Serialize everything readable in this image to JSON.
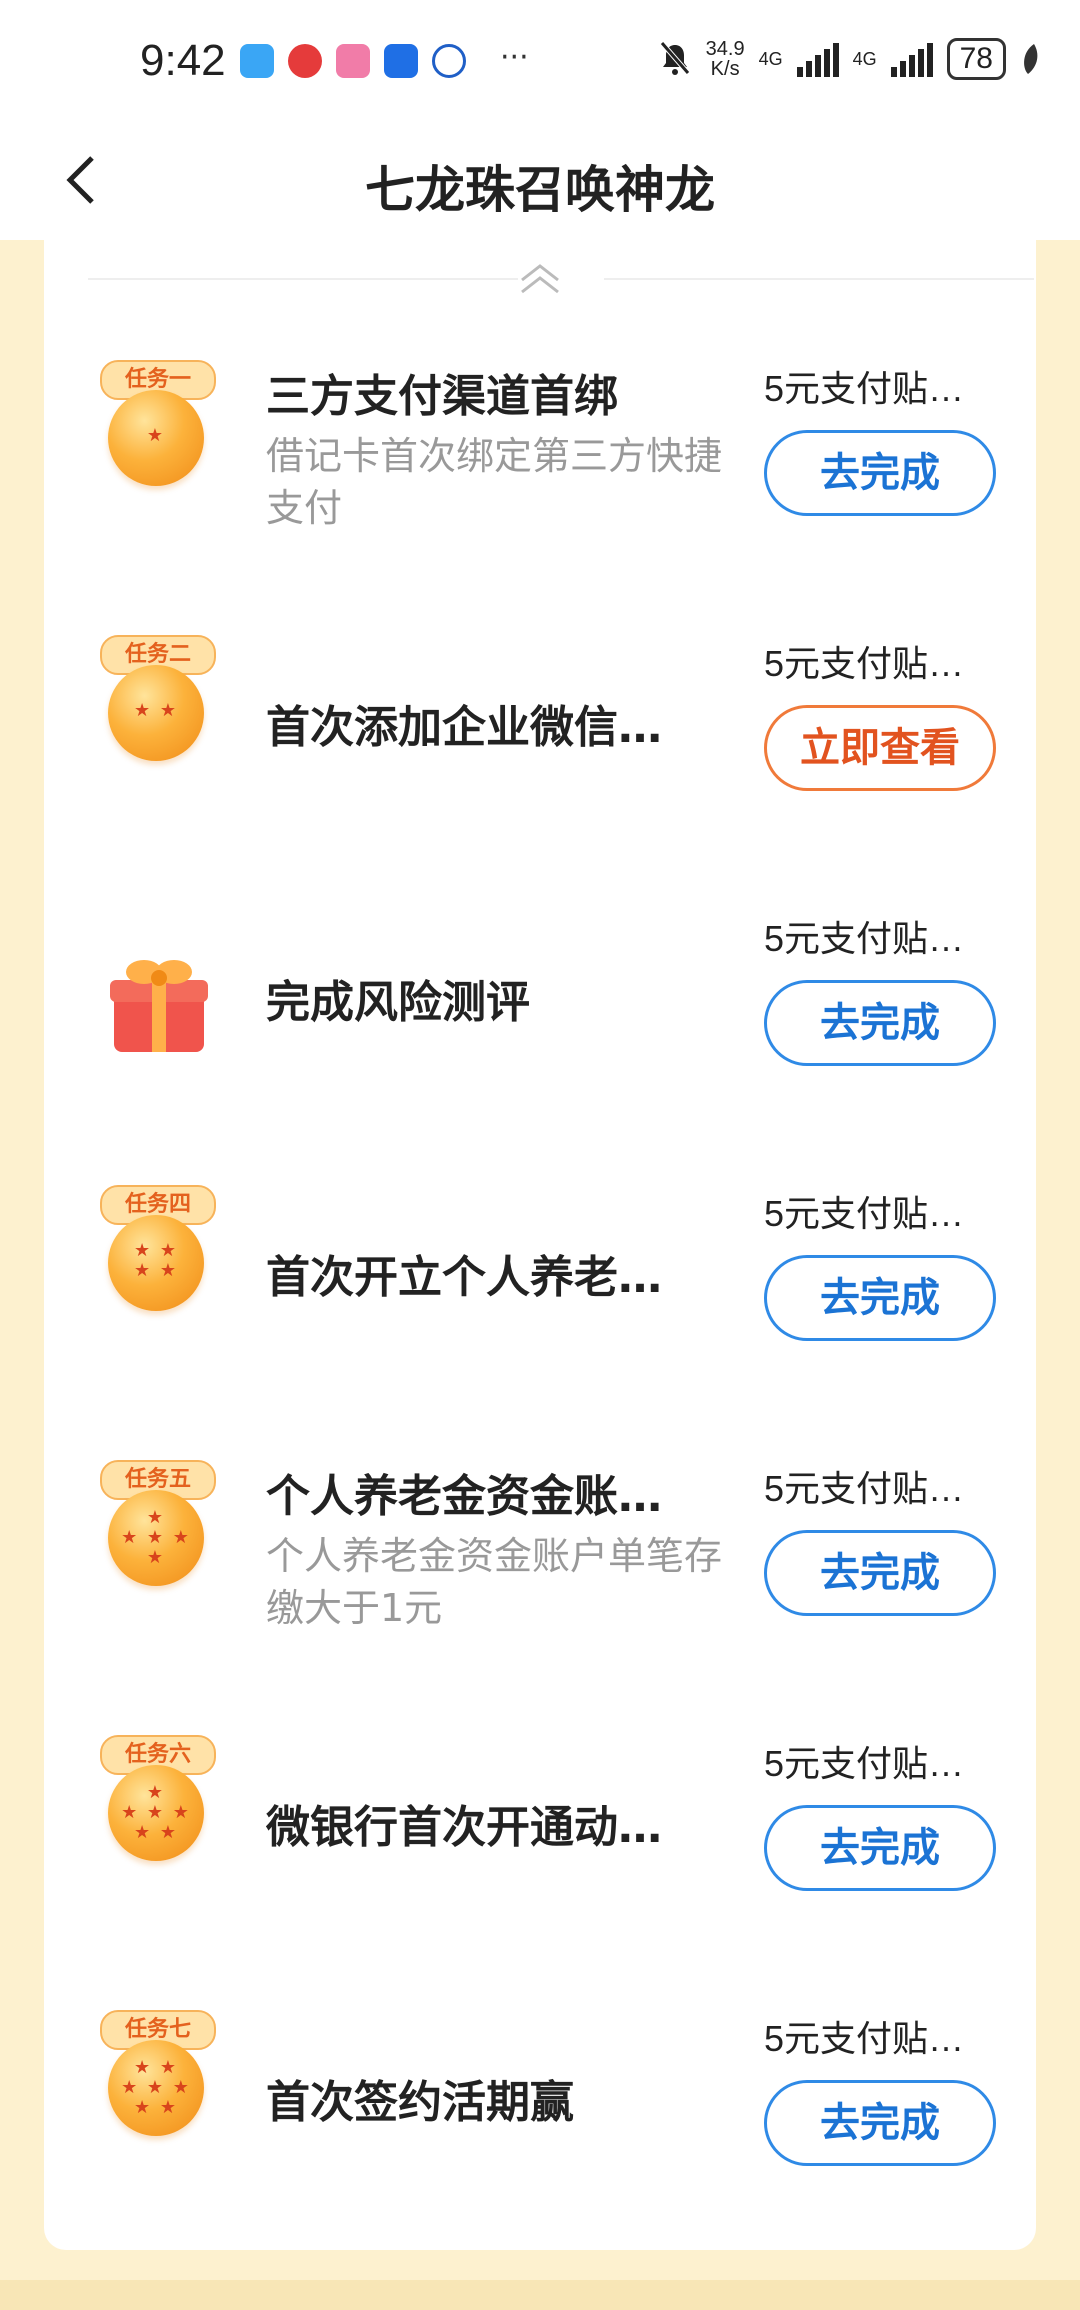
{
  "status_bar": {
    "time": "9:42",
    "app_icons": [
      "message-icon",
      "zhi-icon",
      "clown-icon",
      "bulb-icon",
      "lens-icon"
    ],
    "more": "···",
    "net_speed_value": "34.9",
    "net_speed_unit": "K/s",
    "signal1": "4G",
    "signal2": "4G",
    "battery": "78"
  },
  "header": {
    "title": "七龙珠召唤神龙",
    "back_icon": "chevron-left-icon"
  },
  "collapse_icon": "double-chevron-up-icon",
  "tasks": [
    {
      "tag": "任务一",
      "stars": "★",
      "title": "三方支付渠道首绑",
      "desc": "借记卡首次绑定第三方快捷支付",
      "reward": "5元支付贴…",
      "button": "去完成",
      "button_style": "blue"
    },
    {
      "tag": "任务二",
      "stars": "★ ★",
      "title": "首次添加企业微信…",
      "desc": "",
      "reward": "5元支付贴…",
      "button": "立即查看",
      "button_style": "orange"
    },
    {
      "tag": "",
      "stars": "",
      "title": "完成风险测评",
      "desc": "",
      "reward": "5元支付贴…",
      "button": "去完成",
      "button_style": "blue",
      "icon": "gift-icon"
    },
    {
      "tag": "任务四",
      "stars": "★ ★\n★ ★",
      "title": "首次开立个人养老…",
      "desc": "",
      "reward": "5元支付贴…",
      "button": "去完成",
      "button_style": "blue"
    },
    {
      "tag": "任务五",
      "stars": "★\n★ ★ ★\n★",
      "title": "个人养老金资金账…",
      "desc": "个人养老金资金账户单笔存缴大于1元",
      "reward": "5元支付贴…",
      "button": "去完成",
      "button_style": "blue"
    },
    {
      "tag": "任务六",
      "stars": "★\n★ ★ ★\n★ ★",
      "title": "微银行首次开通动…",
      "desc": "",
      "reward": "5元支付贴…",
      "button": "去完成",
      "button_style": "blue"
    },
    {
      "tag": "任务七",
      "stars": "★ ★\n★ ★ ★\n★ ★",
      "title": "首次签约活期赢",
      "desc": "",
      "reward": "5元支付贴…",
      "button": "去完成",
      "button_style": "blue"
    }
  ]
}
